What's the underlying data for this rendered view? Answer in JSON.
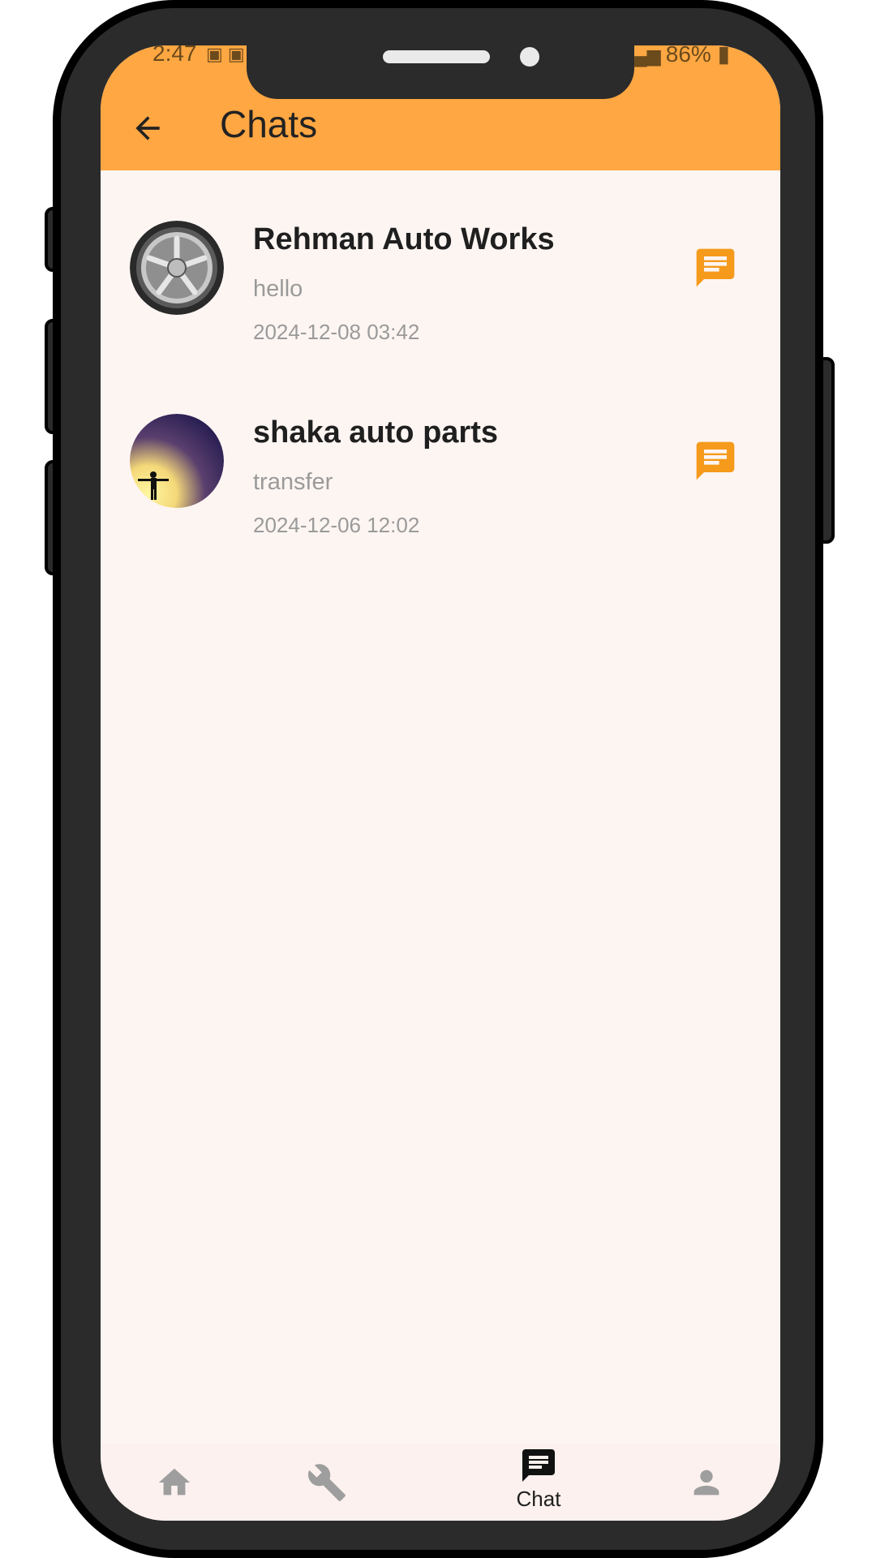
{
  "status_bar": {
    "time": "2:47",
    "battery": "86%"
  },
  "header": {
    "title": "Chats"
  },
  "chats": [
    {
      "name": "Rehman Auto Works",
      "last_message": "hello",
      "timestamp": "2024-12-08   03:42"
    },
    {
      "name": "shaka auto parts",
      "last_message": "transfer",
      "timestamp": "2024-12-06   12:02"
    }
  ],
  "bottom_nav": {
    "active_label": "Chat"
  },
  "colors": {
    "accent": "#ffa742",
    "icon_orange": "#f59a1b",
    "background": "#fdf5f2"
  }
}
